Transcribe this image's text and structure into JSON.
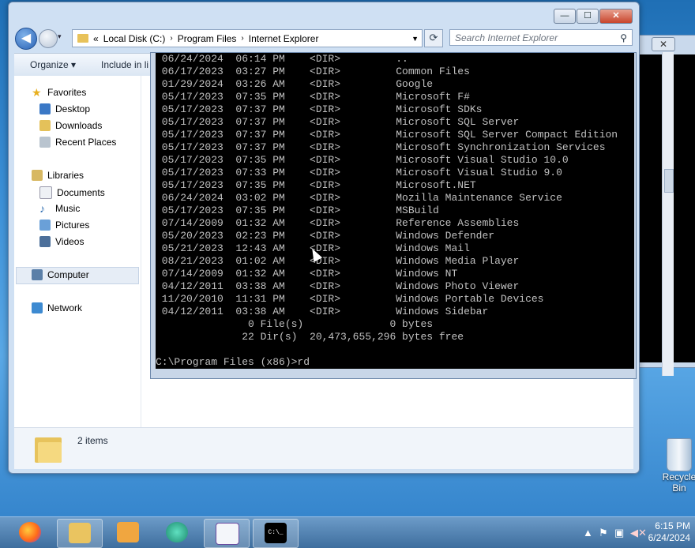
{
  "explorer": {
    "caption": {
      "minimize": "—",
      "maximize": "☐",
      "close": "✕"
    },
    "address": {
      "overflow": "«",
      "crumbs": [
        "Local Disk (C:)",
        "Program Files",
        "Internet Explorer"
      ],
      "separator": "›"
    },
    "search_placeholder": "Search Internet Explorer",
    "toolbar": {
      "organize": "Organize ▾",
      "include": "Include in li"
    },
    "nav": {
      "favorites": "Favorites",
      "desktop": "Desktop",
      "downloads": "Downloads",
      "recent": "Recent Places",
      "libraries": "Libraries",
      "documents": "Documents",
      "music": "Music",
      "pictures": "Pictures",
      "videos": "Videos",
      "computer": "Computer",
      "network": "Network"
    },
    "status": "2 items"
  },
  "console": {
    "rows": [
      [
        "06/24/2024",
        "06:14 PM",
        "<DIR>",
        ".."
      ],
      [
        "06/17/2023",
        "03:27 PM",
        "<DIR>",
        "Common Files"
      ],
      [
        "01/29/2024",
        "03:26 AM",
        "<DIR>",
        "Google"
      ],
      [
        "05/17/2023",
        "07:35 PM",
        "<DIR>",
        "Microsoft F#"
      ],
      [
        "05/17/2023",
        "07:37 PM",
        "<DIR>",
        "Microsoft SDKs"
      ],
      [
        "05/17/2023",
        "07:37 PM",
        "<DIR>",
        "Microsoft SQL Server"
      ],
      [
        "05/17/2023",
        "07:37 PM",
        "<DIR>",
        "Microsoft SQL Server Compact Edition"
      ],
      [
        "05/17/2023",
        "07:37 PM",
        "<DIR>",
        "Microsoft Synchronization Services"
      ],
      [
        "05/17/2023",
        "07:35 PM",
        "<DIR>",
        "Microsoft Visual Studio 10.0"
      ],
      [
        "05/17/2023",
        "07:33 PM",
        "<DIR>",
        "Microsoft Visual Studio 9.0"
      ],
      [
        "05/17/2023",
        "07:35 PM",
        "<DIR>",
        "Microsoft.NET"
      ],
      [
        "06/24/2024",
        "03:02 PM",
        "<DIR>",
        "Mozilla Maintenance Service"
      ],
      [
        "05/17/2023",
        "07:35 PM",
        "<DIR>",
        "MSBuild"
      ],
      [
        "07/14/2009",
        "01:32 AM",
        "<DIR>",
        "Reference Assemblies"
      ],
      [
        "05/20/2023",
        "02:23 PM",
        "<DIR>",
        "Windows Defender"
      ],
      [
        "05/21/2023",
        "12:43 AM",
        "<DIR>",
        "Windows Mail"
      ],
      [
        "08/21/2023",
        "01:02 AM",
        "<DIR>",
        "Windows Media Player"
      ],
      [
        "07/14/2009",
        "01:32 AM",
        "<DIR>",
        "Windows NT"
      ],
      [
        "04/12/2011",
        "03:38 AM",
        "<DIR>",
        "Windows Photo Viewer"
      ],
      [
        "11/20/2010",
        "11:31 PM",
        "<DIR>",
        "Windows Portable Devices"
      ],
      [
        "04/12/2011",
        "03:38 AM",
        "<DIR>",
        "Windows Sidebar"
      ]
    ],
    "summary_files": "               0 File(s)              0 bytes",
    "summary_dirs": "              22 Dir(s)  20,473,655,296 bytes free",
    "prompt": "C:\\Program Files (x86)>rd"
  },
  "back_window": {
    "close": "✕"
  },
  "desktop": {
    "recycle_bin": "Recycle Bin"
  },
  "taskbar": {
    "clock_time": "6:15 PM",
    "clock_date": "6/24/2024",
    "console_label": "C:\\_"
  },
  "colors": {
    "console_bg": "#000000",
    "console_fg": "#c0c0c0",
    "taskbar": "#3e6e9e"
  }
}
